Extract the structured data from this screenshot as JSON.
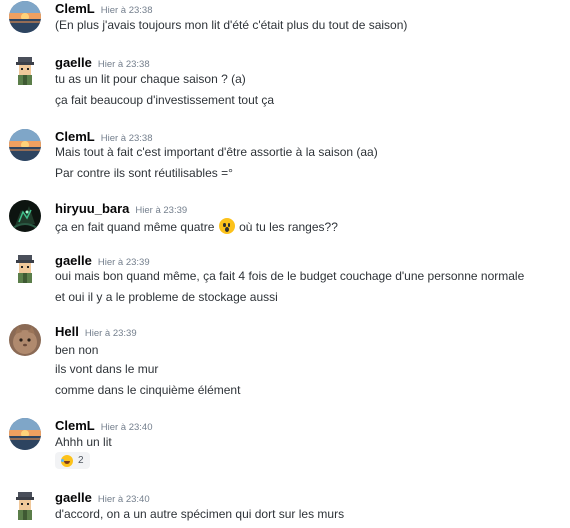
{
  "messages": [
    {
      "author": "ClemL",
      "timestamp": "Hier à 23:38",
      "avatar": "sunset-avatar",
      "lines": [
        "(En plus j'avais toujours mon lit d'été c'était plus du tout de saison)"
      ]
    },
    {
      "author": "gaelle",
      "timestamp": "Hier à 23:38",
      "avatar": "character-avatar",
      "lines": [
        "tu as un lit pour chaque saison ? (a)",
        "ça fait beaucoup d'investissement tout ça"
      ]
    },
    {
      "author": "ClemL",
      "timestamp": "Hier à 23:38",
      "avatar": "sunset-avatar",
      "lines": [
        "Mais tout à fait c'est important d'être assortie à la saison (aa)",
        "Par contre ils sont réutilisables =°"
      ]
    },
    {
      "author": "hiryuu_bara",
      "timestamp": "Hier à 23:39",
      "avatar": "dark-dragon-avatar",
      "lines": [
        "ça en fait quand même quatre",
        "où tu les ranges??"
      ]
    },
    {
      "author": "gaelle",
      "timestamp": "Hier à 23:39",
      "avatar": "character-avatar",
      "lines": [
        "oui mais bon quand même, ça fait 4 fois de le budget couchage d'une personne normale",
        "et oui il y a le probleme de stockage aussi"
      ]
    },
    {
      "author": "Hell",
      "timestamp": "Hier à 23:39",
      "avatar": "cat-avatar",
      "lines": [
        "ben non",
        "ils vont dans le mur",
        "comme dans le cinquième élément"
      ]
    },
    {
      "author": "ClemL",
      "timestamp": "Hier à 23:40",
      "avatar": "sunset-avatar",
      "lines": [
        "Ahhh un lit"
      ],
      "reaction": {
        "emoji": "joy-emoji",
        "count": "2"
      }
    },
    {
      "author": "gaelle",
      "timestamp": "Hier à 23:40",
      "avatar": "character-avatar",
      "lines": [
        "d'accord, on a un autre spécimen qui dort sur les murs"
      ]
    }
  ]
}
